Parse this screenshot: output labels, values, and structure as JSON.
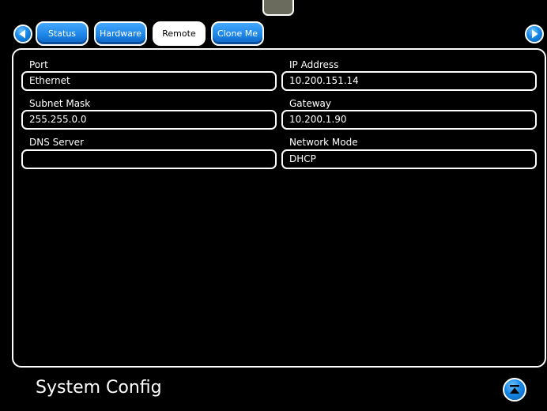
{
  "tabs": {
    "status": "Status",
    "hardware": "Hardware",
    "remote": "Remote",
    "clone": "Clone Me"
  },
  "fields": {
    "port": {
      "label": "Port",
      "value": "Ethernet"
    },
    "ip_address": {
      "label": "IP Address",
      "value": "10.200.151.14"
    },
    "subnet_mask": {
      "label": "Subnet Mask",
      "value": "255.255.0.0"
    },
    "gateway": {
      "label": "Gateway",
      "value": "10.200.1.90"
    },
    "dns_server": {
      "label": "DNS Server",
      "value": ""
    },
    "network_mode": {
      "label": "Network Mode",
      "value": "DHCP"
    }
  },
  "footer": {
    "title": "System Config"
  },
  "icons": {
    "prev": "left-arrow-icon",
    "next": "right-arrow-icon",
    "scroll_top": "scroll-to-top-icon"
  },
  "colors": {
    "accent": "#1d86e8",
    "background": "#000000",
    "foreground": "#ffffff"
  }
}
